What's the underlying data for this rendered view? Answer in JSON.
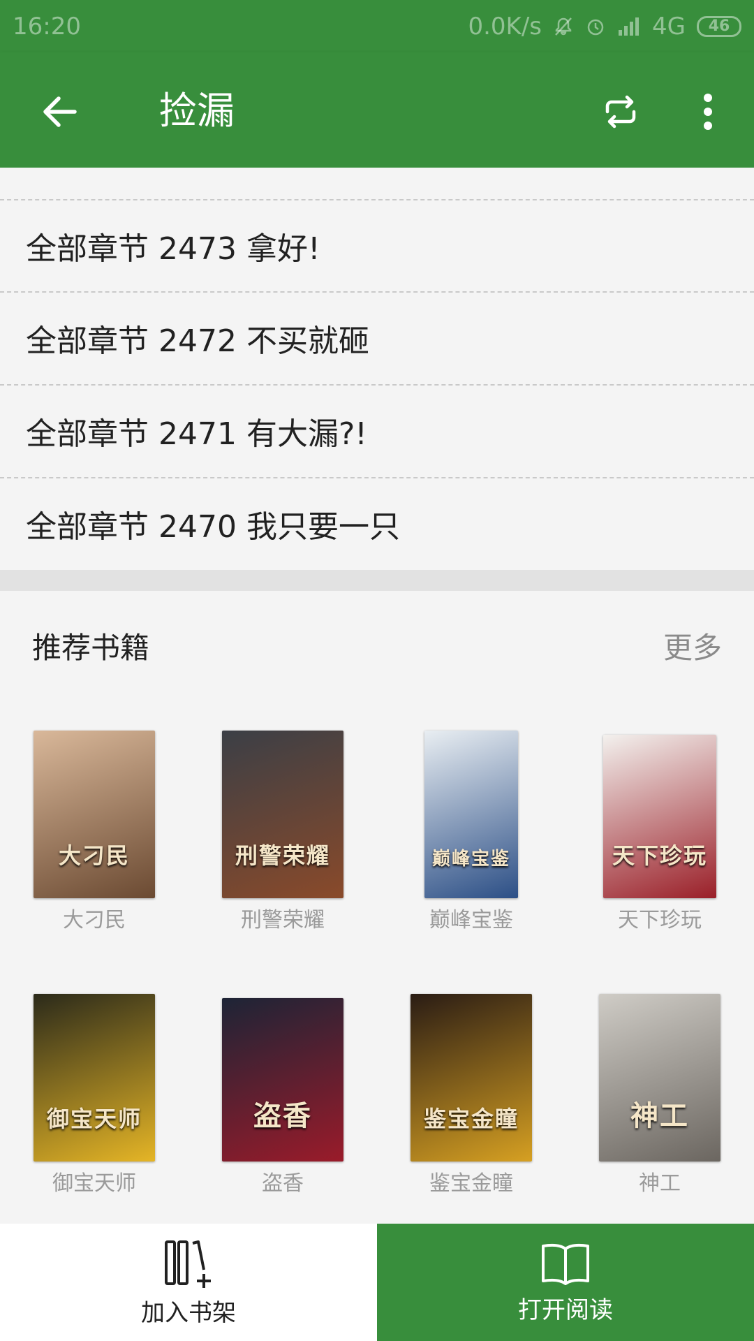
{
  "status_bar": {
    "time": "16:20",
    "net_speed": "0.0K/s",
    "network": "4G",
    "battery": "46"
  },
  "app_bar": {
    "title": "捡漏"
  },
  "chapters": [
    "全部章节 2473 拿好!",
    "全部章节 2472  不买就砸",
    "全部章节 2471 有大漏?!",
    "全部章节 2470 我只要一只"
  ],
  "recommend": {
    "title": "推荐书籍",
    "more_label": "更多",
    "books": [
      {
        "name": "大刁民",
        "cover_text": "大刁民",
        "color1": "#d9b89a",
        "color2": "#6b4a32"
      },
      {
        "name": "刑警荣耀",
        "cover_text": "刑警荣耀",
        "color1": "#3b3f46",
        "color2": "#8a4a2a"
      },
      {
        "name": "巅峰宝鉴",
        "cover_text": "巅峰宝鉴",
        "color1": "#e9eef2",
        "color2": "#2c4f86"
      },
      {
        "name": "天下珍玩",
        "cover_text": "天下珍玩",
        "color1": "#f3f1ee",
        "color2": "#9a1f28"
      },
      {
        "name": "御宝天师",
        "cover_text": "御宝天师",
        "color1": "#2b2a1a",
        "color2": "#e5b526"
      },
      {
        "name": "盗香",
        "cover_text": "盗香",
        "color1": "#1d2436",
        "color2": "#9a1b2a"
      },
      {
        "name": "鉴宝金瞳",
        "cover_text": "鉴宝金瞳",
        "color1": "#2a1c14",
        "color2": "#d6a022"
      },
      {
        "name": "神工",
        "cover_text": "神工",
        "color1": "#cfccc6",
        "color2": "#6b6660"
      }
    ]
  },
  "bottom_bar": {
    "add_shelf_label": "加入书架",
    "open_read_label": "打开阅读"
  },
  "colors": {
    "primary": "#388e3c",
    "background": "#f4f4f4",
    "text": "#212121",
    "muted": "#9a9a9a"
  }
}
